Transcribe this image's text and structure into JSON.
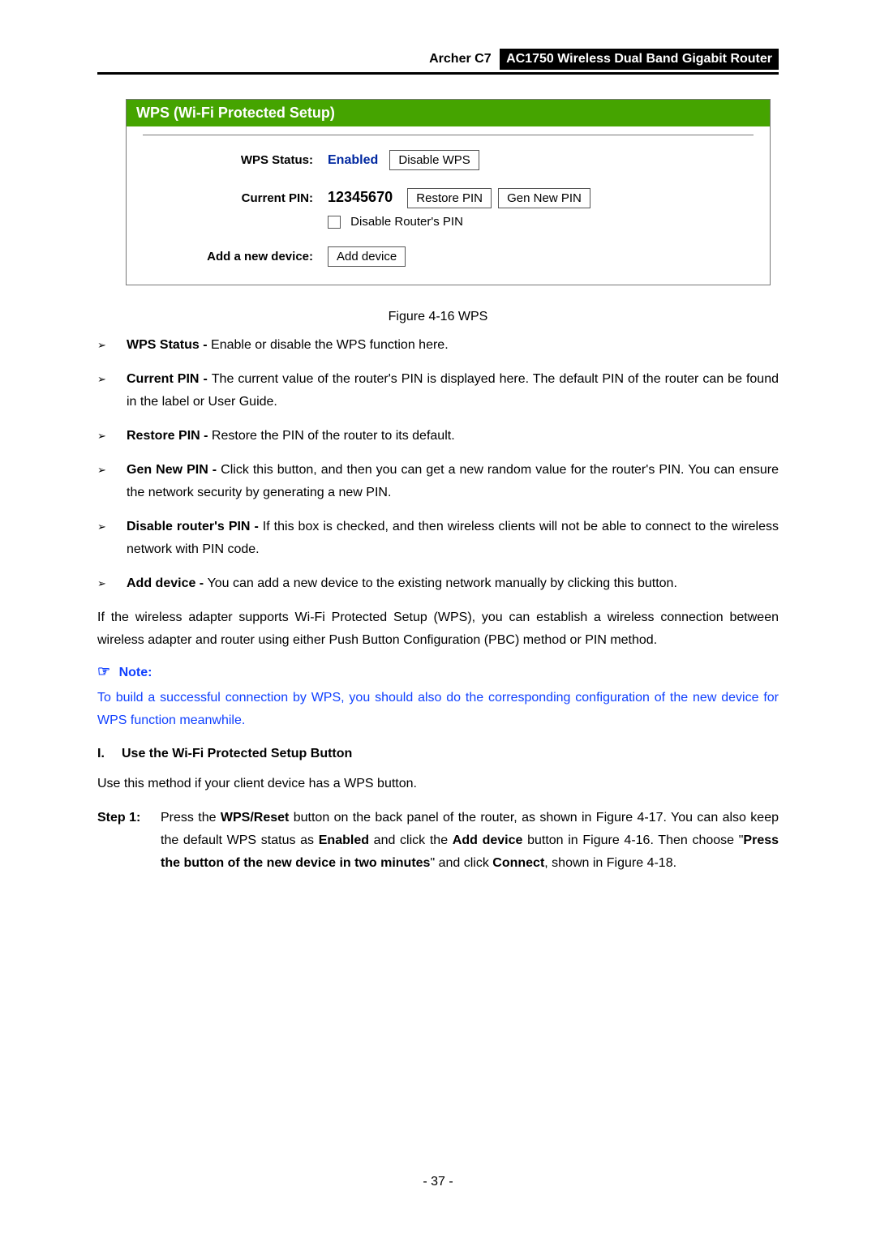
{
  "header": {
    "model": "Archer C7",
    "title": "AC1750 Wireless Dual Band Gigabit Router"
  },
  "panel": {
    "title": "WPS (Wi-Fi Protected Setup)",
    "status_label": "WPS Status:",
    "status_value": "Enabled",
    "disable_wps_btn": "Disable WPS",
    "pin_label": "Current PIN:",
    "pin_value": "12345670",
    "restore_pin_btn": "Restore PIN",
    "gen_new_pin_btn": "Gen New PIN",
    "disable_pin_checkbox": "Disable Router's PIN",
    "add_device_label": "Add a new device:",
    "add_device_btn": "Add device"
  },
  "figure_caption": "Figure 4-16 WPS",
  "bullets": [
    {
      "title": "WPS Status - ",
      "text": "Enable or disable the WPS function here."
    },
    {
      "title": "Current PIN - ",
      "text": "The current value of the router's PIN is displayed here. The default PIN of the router can be found in the label or User Guide."
    },
    {
      "title": "Restore PIN - ",
      "text": "Restore the PIN of the router to its default."
    },
    {
      "title": "Gen New PIN - ",
      "text": "Click this button, and then you can get a new random value for the router's PIN. You can ensure the network security by generating a new PIN."
    },
    {
      "title": "Disable router's PIN - ",
      "text": "If this box is checked, and then wireless clients will not be able to connect to the wireless network with PIN code."
    },
    {
      "title": "Add device - ",
      "text": "You can add a new device to the existing network manually by clicking this button."
    }
  ],
  "paragraph1": "If the wireless adapter supports Wi-Fi Protected Setup (WPS), you can establish a wireless connection between wireless adapter and router using either Push Button Configuration (PBC) method or PIN method.",
  "note_label": "Note:",
  "note_text": "To build a successful connection by WPS, you should also do the corresponding configuration of the new device for WPS function meanwhile.",
  "section_num": "I.",
  "section_title": "Use the Wi-Fi Protected Setup Button",
  "paragraph2": "Use this method if your client device has a WPS button.",
  "step1": {
    "label": "Step 1:",
    "p1a": "Press the ",
    "b1": "WPS/Reset",
    "p1b": " button on the back panel of the router, as shown in Figure 4-17. You can also keep the default WPS status as ",
    "b2": "Enabled",
    "p1c": " and click the ",
    "b3": "Add device",
    "p1d": " button in Figure 4-16. Then choose \"",
    "b4": "Press the button of the new device in two minutes",
    "p1e": "\" and click ",
    "b5": "Connect",
    "p1f": ", shown in Figure 4-18."
  },
  "page_number": "- 37 -"
}
